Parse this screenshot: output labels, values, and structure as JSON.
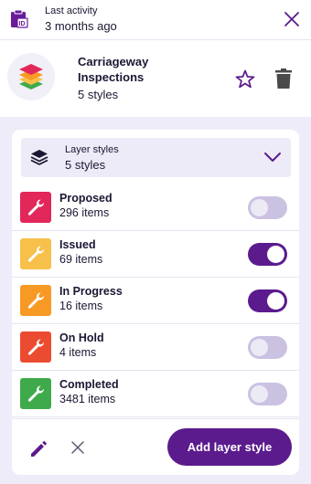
{
  "header": {
    "activity_label": "Last activity",
    "activity_value": "3 months ago",
    "icons": {
      "left": "clipboard-id-icon",
      "close": "close-icon"
    }
  },
  "summary": {
    "name": "Carriageway Inspections",
    "count": "5 styles",
    "icons": {
      "avatar": "layered-stack-icon",
      "favorite": "star-outline-icon",
      "delete": "trash-icon"
    }
  },
  "dropdown": {
    "label": "Layer styles",
    "value": "5 styles",
    "icon": "layers-icon",
    "chevron": "chevron-down-icon"
  },
  "layers": [
    {
      "title": "Proposed",
      "items": "296 items",
      "color": "#e2275b",
      "enabled": false
    },
    {
      "title": "Issued",
      "items": "69 items",
      "color": "#f7c04a",
      "enabled": true
    },
    {
      "title": "In Progress",
      "items": "16 items",
      "color": "#f79a25",
      "enabled": true
    },
    {
      "title": "On Hold",
      "items": "4 items",
      "color": "#eb4c31",
      "enabled": false
    },
    {
      "title": "Completed",
      "items": "3481 items",
      "color": "#3faa4c",
      "enabled": false
    }
  ],
  "footer": {
    "add_label": "Add layer style",
    "icons": {
      "edit": "pencil-icon",
      "cancel": "close-icon"
    }
  },
  "colors": {
    "accent": "#5b1b8d",
    "toggle_off": "#cbc2e2",
    "panel_background": "#efecf9"
  }
}
